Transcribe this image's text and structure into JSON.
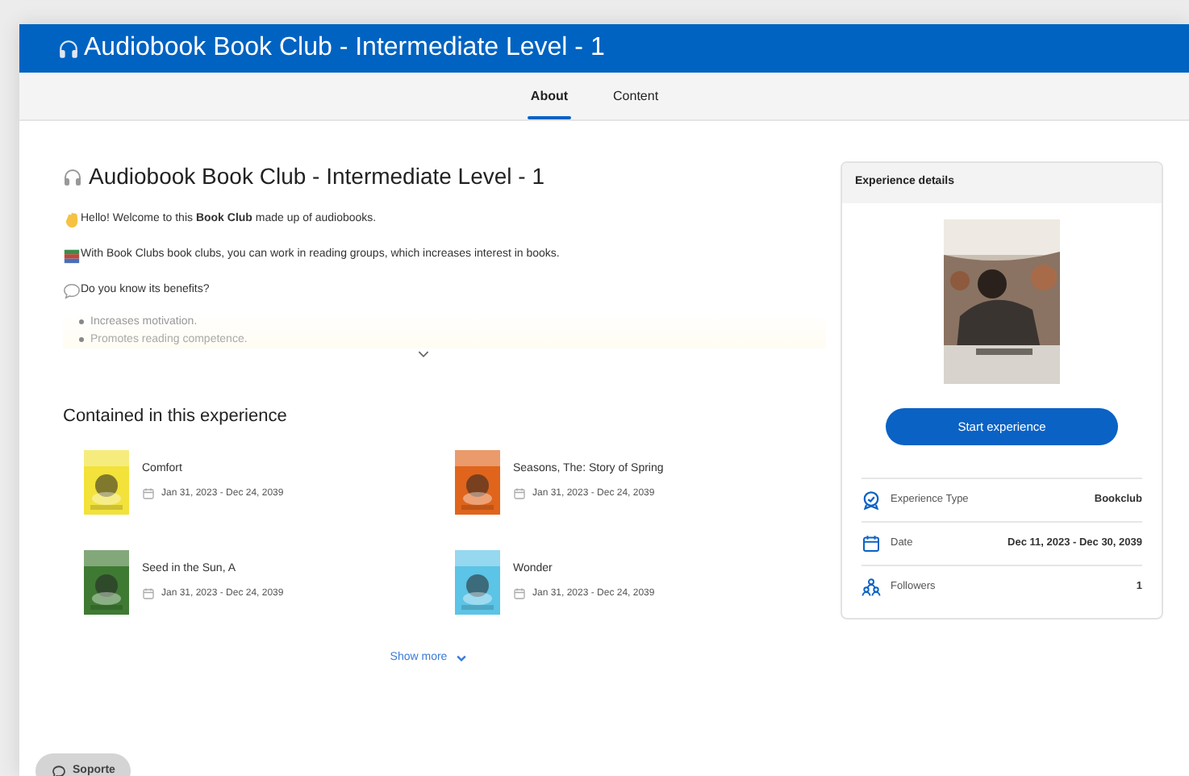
{
  "header": {
    "title": "Audiobook Book Club - Intermediate Level - 1"
  },
  "tabs": [
    {
      "label": "About",
      "selected": true
    },
    {
      "label": "Content",
      "selected": false
    }
  ],
  "about": {
    "title": "Audiobook Book Club - Intermediate Level - 1",
    "paragraphs": [
      {
        "text": "Hello! Welcome to this **Book Club** made up of audiobooks."
      },
      {
        "text": "With Book Clubs book clubs, you can work in reading groups, which increases interest in books."
      },
      {
        "text": "Do you know its benefits?"
      }
    ],
    "bullets": [
      "Increases motivation.",
      "Promotes reading competence."
    ]
  },
  "contained": {
    "title": "Contained in this experience",
    "items": [
      {
        "title": "Comfort",
        "dates": "Jan 31, 2023 - Dec 24, 2039"
      },
      {
        "title": "Seasons, The: Story of Spring",
        "dates": "Jan 31, 2023 - Dec 24, 2039"
      },
      {
        "title": "Seed in the Sun, A",
        "dates": "Jan 31, 2023 - Dec 24, 2039"
      },
      {
        "title": "Wonder",
        "dates": "Jan 31, 2023 - Dec 24, 2039"
      }
    ],
    "show_more": "Show more"
  },
  "details": {
    "title": "Experience details",
    "button": "Start experience",
    "rows": [
      {
        "kind": "type",
        "label": "Experience Type",
        "value": "Bookclub"
      },
      {
        "kind": "date",
        "label": "Date",
        "value": "Dec 11, 2023 - Dec 30, 2039"
      },
      {
        "kind": "followers",
        "label": "Followers",
        "value": "1"
      }
    ]
  },
  "support": {
    "label": "Soporte"
  }
}
